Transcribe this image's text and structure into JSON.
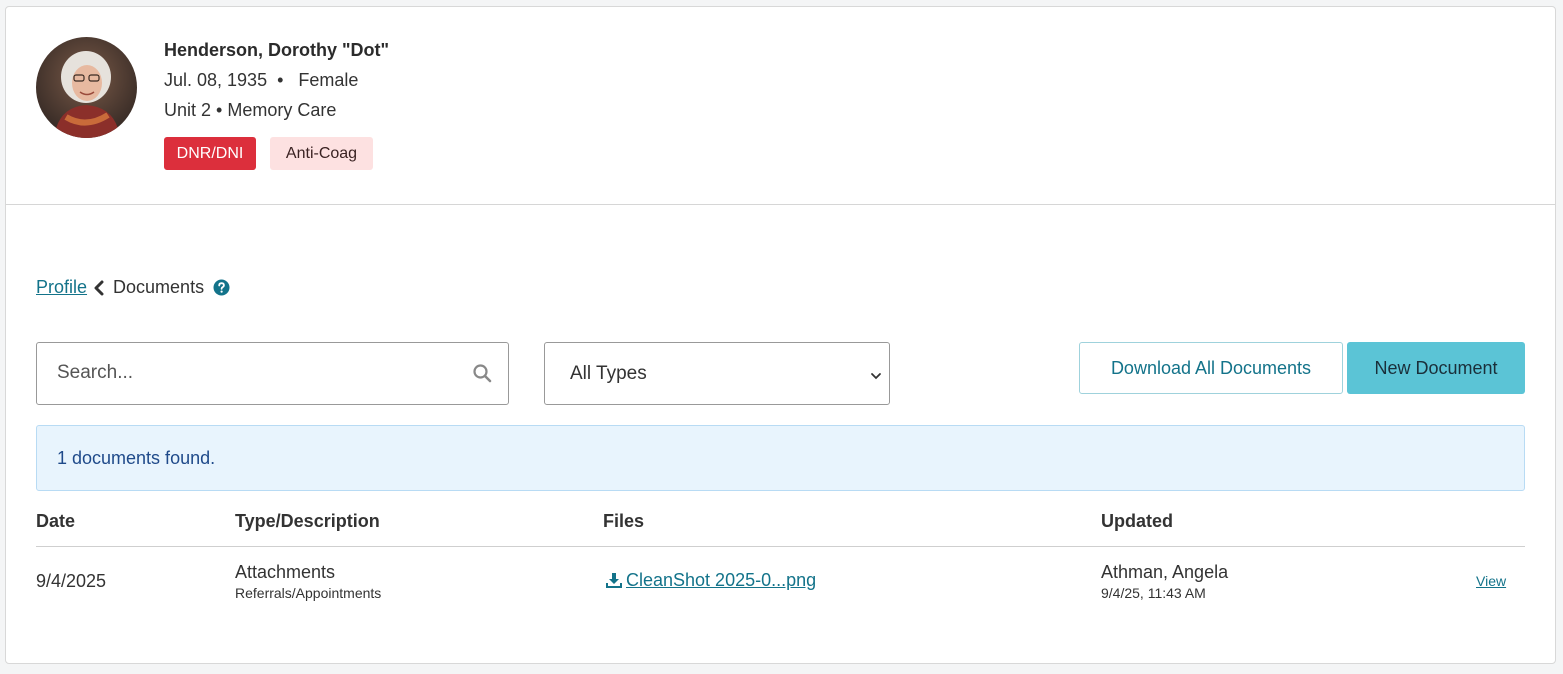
{
  "patient": {
    "name": "Henderson, Dorothy \"Dot\"",
    "dob": "Jul. 08, 1935",
    "sex": "Female",
    "unit": "Unit 2",
    "care": "Memory Care",
    "badges": [
      {
        "label": "DNR/DNI",
        "color": "#dc2f3c"
      },
      {
        "label": "Anti-Coag",
        "color": "#fde1e1"
      }
    ]
  },
  "breadcrumb": {
    "parent": "Profile",
    "current": "Documents"
  },
  "toolbar": {
    "search_placeholder": "Search...",
    "type_filter": "All Types",
    "download_label": "Download All Documents",
    "new_label": "New Document"
  },
  "alert": {
    "text": "1 documents found."
  },
  "table": {
    "headers": [
      "Date",
      "Type/Description",
      "Files",
      "Updated"
    ],
    "rows": [
      {
        "date": "9/4/2025",
        "type": "Attachments",
        "description": "Referrals/Appointments",
        "file": "CleanShot 2025-0...png",
        "updated_by": "Athman, Angela",
        "updated_at": "9/4/25, 11:43 AM",
        "action": "View"
      }
    ]
  },
  "colors": {
    "accent": "#13738a",
    "primary_button": "#5bc4d6"
  }
}
